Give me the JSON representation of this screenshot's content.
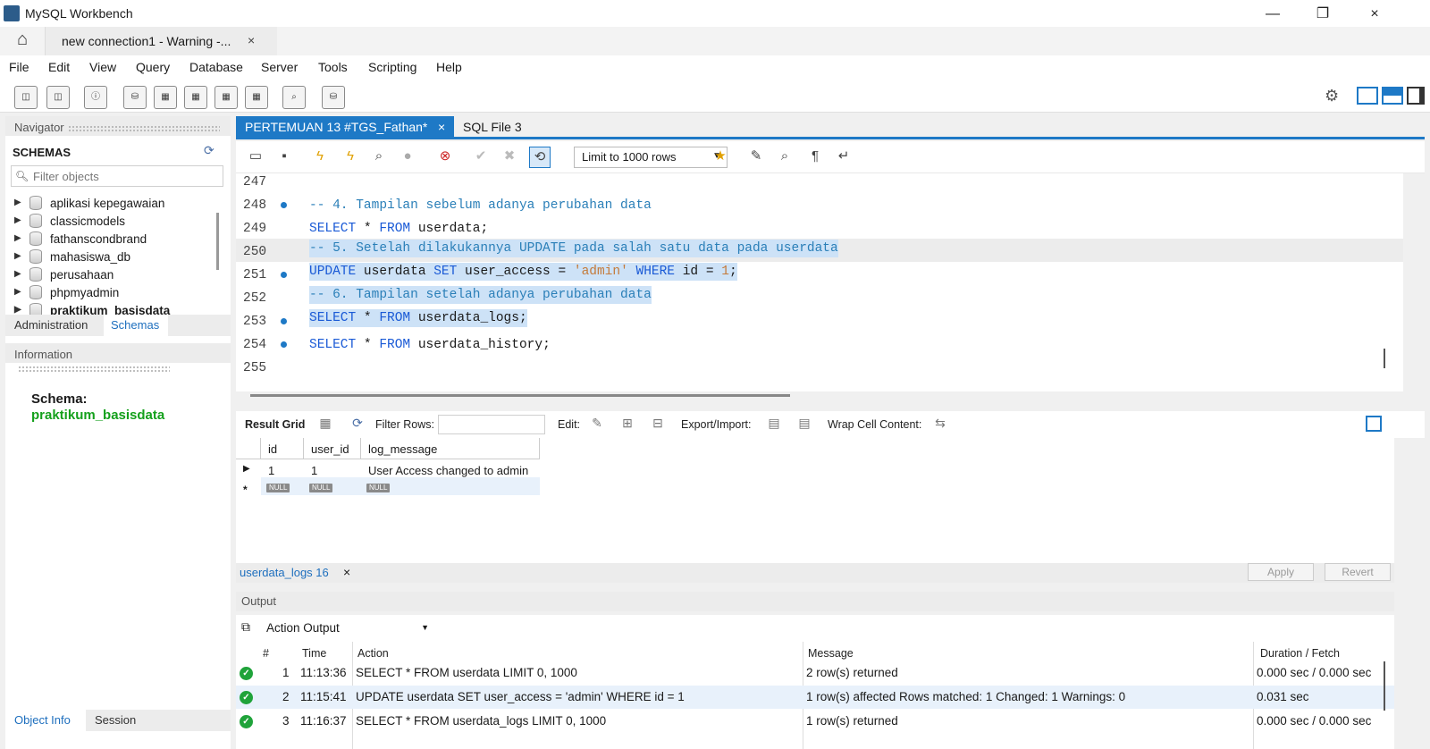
{
  "window": {
    "title": "MySQL Workbench",
    "connection_tab": "new connection1 - Warning -...",
    "close": "×",
    "minimize": "—",
    "restore": "❐"
  },
  "menu": [
    "File",
    "Edit",
    "View",
    "Query",
    "Database",
    "Server",
    "Tools",
    "Scripting",
    "Help"
  ],
  "navigator": {
    "header": "Navigator",
    "schemas_title": "SCHEMAS",
    "filter_placeholder": "Filter objects",
    "schemas": [
      "aplikasi kepegawaian",
      "classicmodels",
      "fathanscondbrand",
      "mahasiswa_db",
      "perusahaan",
      "phpmyadmin",
      "praktikum_basisdata"
    ],
    "active_schema": "praktikum_basisdata",
    "tabs": [
      "Administration",
      "Schemas"
    ],
    "info_header": "Information",
    "info_label": "Schema:",
    "info_value": "praktikum_basisdata",
    "bottom_tabs": [
      "Object Info",
      "Session"
    ]
  },
  "editor": {
    "tabs": [
      {
        "label": "PERTEMUAN 13 #TGS_Fathan*",
        "active": true
      },
      {
        "label": "SQL File 3",
        "active": false
      }
    ],
    "limit": "Limit to 1000 rows",
    "lines": [
      {
        "num": "247",
        "dot": false,
        "text": ""
      },
      {
        "num": "248",
        "dot": true,
        "text": "-- 4. Tampilan sebelum adanya perubahan data"
      },
      {
        "num": "249",
        "dot": false,
        "text": "SELECT * FROM userdata;"
      },
      {
        "num": "250",
        "dot": false,
        "text": "-- 5. Setelah dilakukannya UPDATE pada salah satu data pada userdata"
      },
      {
        "num": "251",
        "dot": true,
        "text": "UPDATE userdata SET user_access = 'admin' WHERE id = 1;"
      },
      {
        "num": "252",
        "dot": false,
        "text": "-- 6. Tampilan setelah adanya perubahan data"
      },
      {
        "num": "253",
        "dot": true,
        "text": "SELECT * FROM userdata_logs;"
      },
      {
        "num": "254",
        "dot": true,
        "text": "SELECT * FROM userdata_history;"
      },
      {
        "num": "255",
        "dot": false,
        "text": ""
      }
    ]
  },
  "result": {
    "toolbar": {
      "result_grid": "Result Grid",
      "filter_rows": "Filter Rows:",
      "edit": "Edit:",
      "export_import": "Export/Import:",
      "wrap": "Wrap Cell Content:"
    },
    "columns": [
      "id",
      "user_id",
      "log_message"
    ],
    "rows": [
      [
        "1",
        "1",
        "User Access changed to admin"
      ]
    ],
    "null_label": "NULL",
    "tab": "userdata_logs 16",
    "apply": "Apply",
    "revert": "Revert"
  },
  "output": {
    "header": "Output",
    "selector": "Action Output",
    "columns": [
      "#",
      "Time",
      "Action",
      "Message",
      "Duration / Fetch"
    ],
    "rows": [
      {
        "n": "1",
        "time": "11:13:36",
        "action": "SELECT * FROM userdata LIMIT 0, 1000",
        "message": "2 row(s) returned",
        "duration": "0.000 sec / 0.000 sec"
      },
      {
        "n": "2",
        "time": "11:15:41",
        "action": "UPDATE userdata SET user_access = 'admin' WHERE id = 1",
        "message": "1 row(s) affected Rows matched: 1  Changed: 1  Warnings: 0",
        "duration": "0.031 sec"
      },
      {
        "n": "3",
        "time": "11:16:37",
        "action": "SELECT * FROM userdata_logs LIMIT 0, 1000",
        "message": "1 row(s) returned",
        "duration": "0.000 sec / 0.000 sec"
      }
    ]
  },
  "colors": {
    "accent": "#1e79c6",
    "success": "#1fa33a",
    "schema_green": "#14a01c",
    "comment": "#2a7fb8",
    "keyword": "#1a5ad6",
    "string": "#c47a3a"
  }
}
